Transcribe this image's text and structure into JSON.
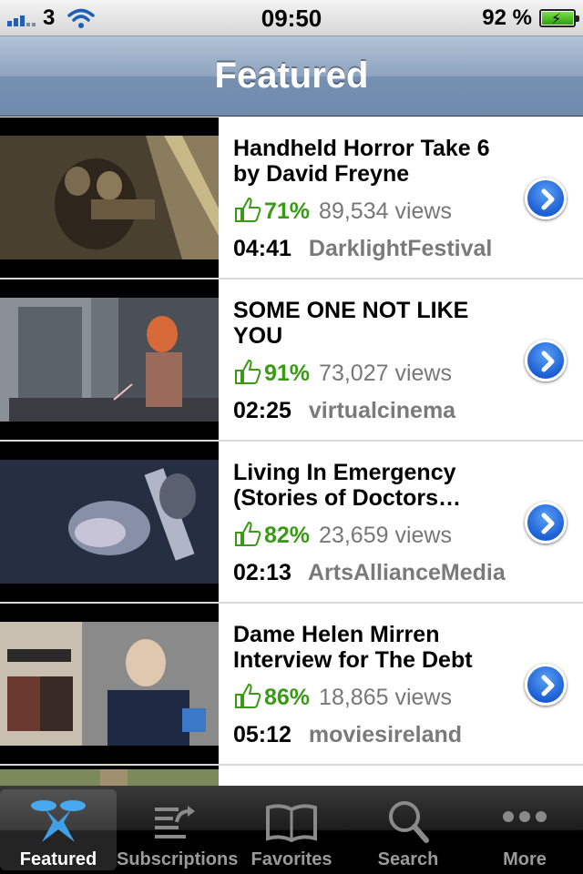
{
  "status_bar": {
    "carrier": "3",
    "time": "09:50",
    "battery": "92 %",
    "icons": [
      "signal-bars-icon",
      "wifi-icon",
      "battery-charging-icon"
    ]
  },
  "nav": {
    "title": "Featured"
  },
  "videos": [
    {
      "title": "Handheld Horror Take 6 by David Freyne",
      "rating": "71%",
      "views": "89,534 views",
      "duration": "04:41",
      "channel": "DarklightFestival"
    },
    {
      "title": "SOME ONE NOT LIKE YOU",
      "rating": "91%",
      "views": "73,027 views",
      "duration": "02:25",
      "channel": "virtualcinema"
    },
    {
      "title": "Living In Emergency (Stories of Doctors…",
      "rating": "82%",
      "views": "23,659 views",
      "duration": "02:13",
      "channel": "ArtsAllianceMedia"
    },
    {
      "title": "Dame Helen Mirren Interview for The Debt",
      "rating": "86%",
      "views": "18,865 views",
      "duration": "05:12",
      "channel": "moviesireland"
    }
  ],
  "tabs": [
    {
      "label": "Featured",
      "icon": "featured-x-icon",
      "active": true
    },
    {
      "label": "Subscriptions",
      "icon": "subscriptions-icon",
      "active": false
    },
    {
      "label": "Favorites",
      "icon": "book-icon",
      "active": false
    },
    {
      "label": "Search",
      "icon": "search-icon",
      "active": false
    },
    {
      "label": "More",
      "icon": "more-dots-icon",
      "active": false
    }
  ],
  "colors": {
    "nav_bar": "#7690b2",
    "rating_green": "#3a9a16",
    "disclosure_blue": "#1c5fd3",
    "tab_bar": "#000000"
  }
}
